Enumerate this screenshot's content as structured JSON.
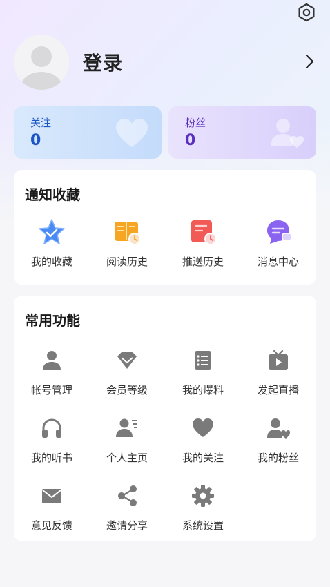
{
  "header": {
    "login_label": "登录",
    "icons": {
      "settings": "hexagon-gear-icon",
      "chevron": "chevron-right-icon",
      "avatar": "default-avatar"
    }
  },
  "stats": {
    "follow": {
      "label": "关注",
      "value": "0",
      "color": "#1a56c6"
    },
    "fans": {
      "label": "粉丝",
      "value": "0",
      "color": "#5a2fc0"
    }
  },
  "notify_section": {
    "title": "通知收藏",
    "items": [
      {
        "label": "我的收藏",
        "icon": "star-check-icon"
      },
      {
        "label": "阅读历史",
        "icon": "open-book-clock-icon"
      },
      {
        "label": "推送历史",
        "icon": "document-clock-icon"
      },
      {
        "label": "消息中心",
        "icon": "chat-bubble-icon"
      }
    ]
  },
  "common_section": {
    "title": "常用功能",
    "items": [
      {
        "label": "帐号管理",
        "icon": "person-icon"
      },
      {
        "label": "会员等级",
        "icon": "diamond-icon"
      },
      {
        "label": "我的爆料",
        "icon": "list-document-icon"
      },
      {
        "label": "发起直播",
        "icon": "tv-play-icon"
      },
      {
        "label": "我的听书",
        "icon": "headphones-icon"
      },
      {
        "label": "个人主页",
        "icon": "profile-card-icon"
      },
      {
        "label": "我的关注",
        "icon": "heart-icon"
      },
      {
        "label": "我的粉丝",
        "icon": "person-heart-icon"
      },
      {
        "label": "意见反馈",
        "icon": "envelope-icon"
      },
      {
        "label": "邀请分享",
        "icon": "share-icon"
      },
      {
        "label": "系统设置",
        "icon": "gear-icon"
      }
    ]
  },
  "colors": {
    "icon_gray": "#7a7a7a",
    "accent_blue": "#3a7cf0",
    "accent_orange": "#f6a623",
    "accent_red": "#f25a55",
    "accent_purple": "#8a63f0"
  }
}
